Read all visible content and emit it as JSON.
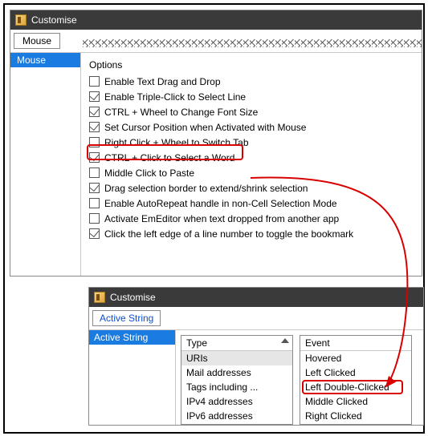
{
  "win1": {
    "title": "Customise",
    "tab": "Mouse",
    "sidebar_item": "Mouse",
    "options_header": "Options",
    "options": [
      {
        "label": "Enable Text Drag and Drop",
        "checked": false
      },
      {
        "label": "Enable Triple-Click to Select Line",
        "checked": true
      },
      {
        "label": "CTRL + Wheel to Change Font Size",
        "checked": true
      },
      {
        "label": "Set Cursor Position when Activated with Mouse",
        "checked": true
      },
      {
        "label": "Right Click + Wheel to Switch Tab",
        "checked": false
      },
      {
        "label": "CTRL + Click to Select a Word",
        "checked": true
      },
      {
        "label": "Middle Click to Paste",
        "checked": false
      },
      {
        "label": "Drag selection border to extend/shrink selection",
        "checked": true
      },
      {
        "label": "Enable AutoRepeat handle in non-Cell Selection Mode",
        "checked": false
      },
      {
        "label": "Activate EmEditor when text dropped from another app",
        "checked": false
      },
      {
        "label": "Click the left edge of a line number to toggle the bookmark",
        "checked": true
      }
    ],
    "highlight_index": 5
  },
  "win2": {
    "title": "Customise",
    "tab": "Active String",
    "sidebar_item": "Active String",
    "type_header": "Type",
    "types": [
      {
        "label": "URIs",
        "selected": true
      },
      {
        "label": "Mail addresses",
        "selected": false
      },
      {
        "label": "Tags including ...",
        "selected": false
      },
      {
        "label": "IPv4 addresses",
        "selected": false
      },
      {
        "label": "IPv6 addresses",
        "selected": false
      }
    ],
    "event_header": "Event",
    "events": [
      "Hovered",
      "Left Clicked",
      "Left Double-Clicked",
      "Middle Clicked",
      "Right Clicked"
    ],
    "event_highlight_index": 2
  }
}
